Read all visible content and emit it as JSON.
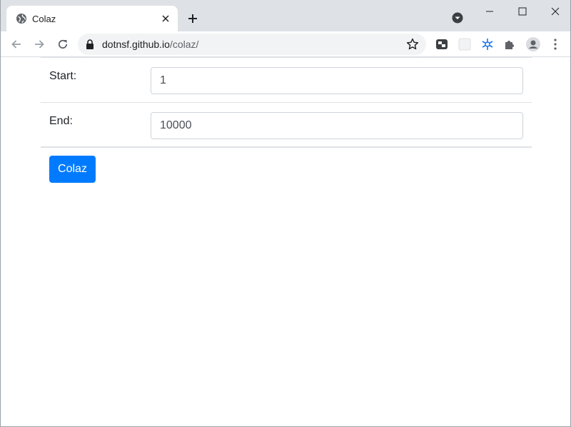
{
  "browser": {
    "tab": {
      "title": "Colaz",
      "favicon": "globe-icon"
    },
    "url": {
      "host": "dotnsf.github.io",
      "path": "/colaz/"
    },
    "icons": [
      "back-arrow-icon",
      "forward-arrow-icon",
      "reload-icon",
      "lock-icon",
      "star-icon",
      "extensions-icon",
      "profile-icon",
      "menu-kebab-icon"
    ],
    "colors": {
      "tabstrip": "#dee1e6",
      "omnibox": "#f1f3f4"
    }
  },
  "form": {
    "start": {
      "label": "Start:",
      "value": "1"
    },
    "end": {
      "label": "End:",
      "value": "10000"
    },
    "submit_label": "Colaz"
  },
  "colors": {
    "primary": "#007bff"
  }
}
